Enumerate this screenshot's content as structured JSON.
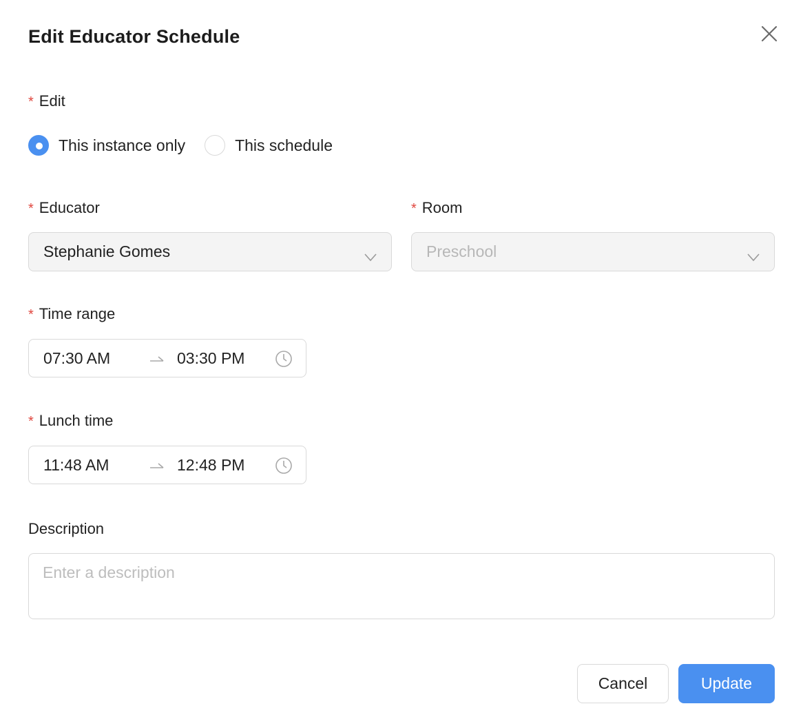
{
  "dialog": {
    "title": "Edit Educator Schedule"
  },
  "edit": {
    "label": "Edit",
    "required_mark": "*",
    "options": [
      {
        "label": "This instance only",
        "checked": true
      },
      {
        "label": "This schedule",
        "checked": false
      }
    ]
  },
  "educator": {
    "label": "Educator",
    "required_mark": "*",
    "value": "Stephanie Gomes"
  },
  "room": {
    "label": "Room",
    "required_mark": "*",
    "value": "Preschool",
    "disabled": true
  },
  "time_range": {
    "label": "Time range",
    "required_mark": "*",
    "start": "07:30 AM",
    "end": "03:30 PM"
  },
  "lunch_time": {
    "label": "Lunch time",
    "required_mark": "*",
    "start": "11:48 AM",
    "end": "12:48 PM"
  },
  "description": {
    "label": "Description",
    "placeholder": "Enter a description",
    "value": ""
  },
  "buttons": {
    "cancel": "Cancel",
    "update": "Update"
  },
  "colors": {
    "primary": "#4a90f0",
    "required": "#e0463e",
    "border": "#d9d9d9",
    "input_bg": "#f4f4f4"
  },
  "icons": {
    "close": "close-icon",
    "chevron": "chevron-down-icon",
    "arrow": "arrow-right-icon",
    "clock": "clock-icon"
  }
}
